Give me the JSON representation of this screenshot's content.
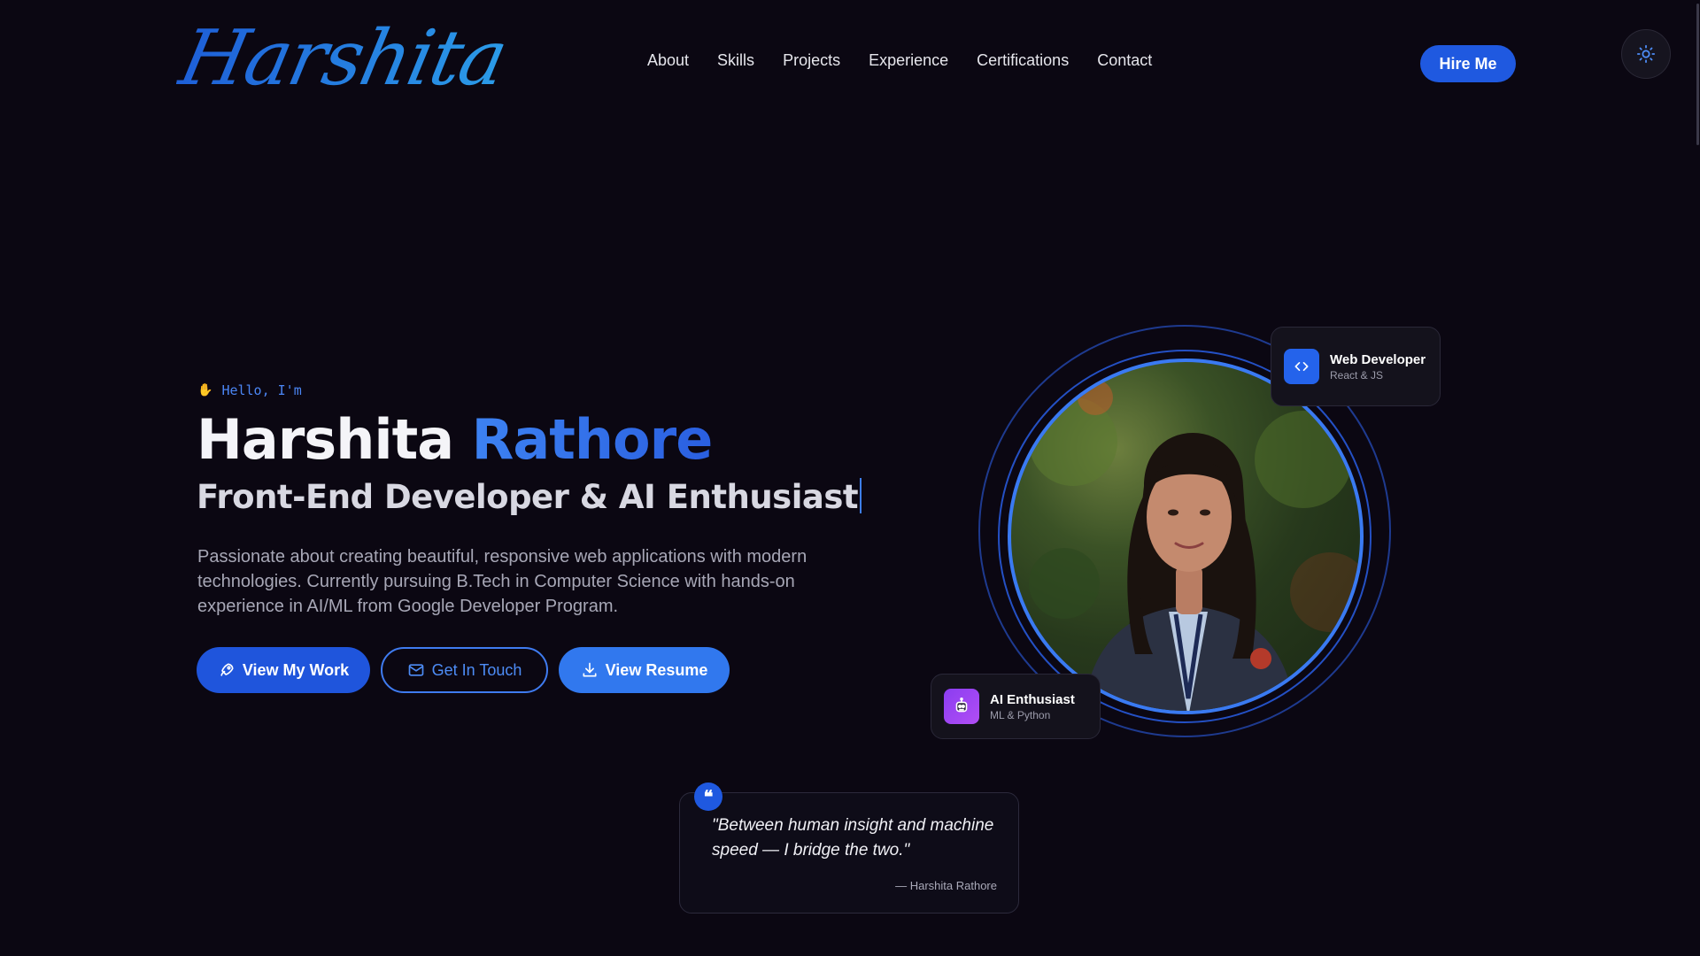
{
  "logo": {
    "text": "Harshita"
  },
  "nav": {
    "items": [
      {
        "label": "About"
      },
      {
        "label": "Skills"
      },
      {
        "label": "Projects"
      },
      {
        "label": "Experience"
      },
      {
        "label": "Certifications"
      },
      {
        "label": "Contact"
      }
    ],
    "hire_label": "Hire Me",
    "theme_icon": "sun-icon"
  },
  "hero": {
    "greeting_icon": "waving-hand-icon",
    "greeting": "Hello, I'm",
    "first_name": "Harshita",
    "last_name": "Rathore",
    "role": "Front-End Developer & AI Enthusiast",
    "description": "Passionate about creating beautiful, responsive web applications with modern technologies. Currently pursuing B.Tech in Computer Science with hands-on experience in AI/ML from Google Developer Program.",
    "buttons": {
      "work": "View My Work",
      "contact": "Get In Touch",
      "resume": "View Resume"
    }
  },
  "badges": {
    "web": {
      "icon": "code-icon",
      "title": "Web Developer",
      "subtitle": "React & JS"
    },
    "ai": {
      "icon": "robot-icon",
      "title": "AI Enthusiast",
      "subtitle": "ML & Python"
    }
  },
  "quote": {
    "text": "\"Between human insight and machine speed — I bridge the two.\"",
    "author": "— Harshita Rathore"
  },
  "colors": {
    "background": "#0b0712",
    "accent": "#1f59e0",
    "accent_light": "#3d82f2",
    "ai_badge": "#8b3df0"
  }
}
